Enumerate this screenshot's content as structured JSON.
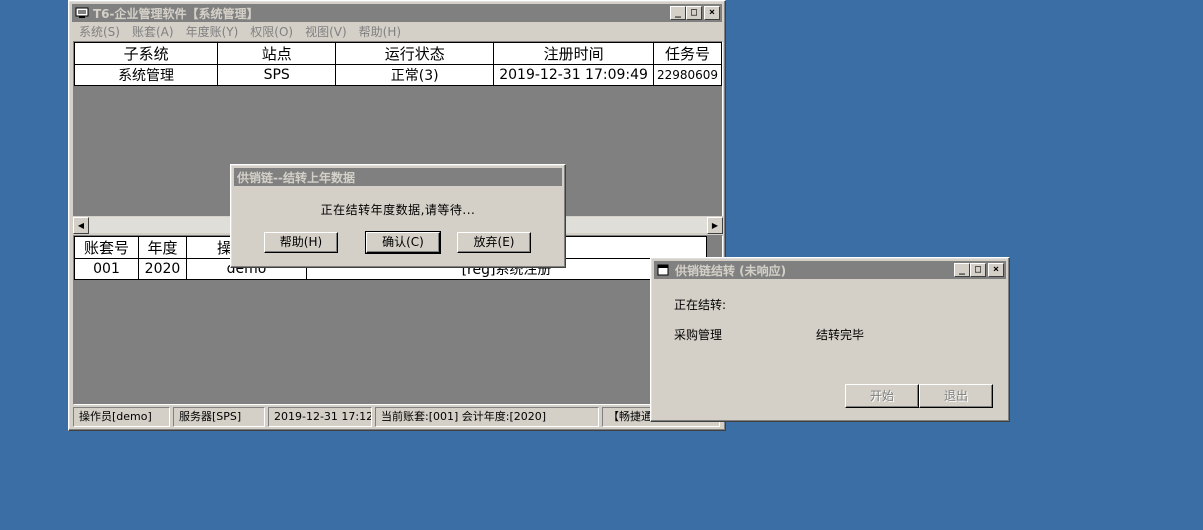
{
  "main_window": {
    "title": "T6-企业管理软件【系统管理】",
    "menu": [
      "系统(S)",
      "账套(A)",
      "年度账(Y)",
      "权限(O)",
      "视图(V)",
      "帮助(H)"
    ],
    "subsystems_table": {
      "columns": [
        "子系统",
        "站点",
        "运行状态",
        "注册时间",
        "任务号"
      ],
      "rows": [
        [
          "系统管理",
          "SPS",
          "正常(3)",
          "2019-12-31 17:09:49",
          "22980609"
        ]
      ]
    },
    "accounts_table": {
      "columns": [
        "账套号",
        "年度",
        "操"
      ],
      "rows": [
        [
          "001",
          "2020",
          "demo",
          "[reg]系统注册"
        ]
      ]
    },
    "status": {
      "operator": "操作员[demo]",
      "server": "服务器[SPS]",
      "datetime": "2019-12-31 17:12",
      "current": "当前账套:[001] 会计年度:[2020]",
      "brand": "【畅捷通软件】"
    }
  },
  "progress_dialog": {
    "title": "供销链--结转上年数据",
    "message": "正在结转年度数据,请等待...",
    "help_label": "帮助(H)",
    "ok_label": "确认(C)",
    "cancel_label": "放弃(E)"
  },
  "transfer_window": {
    "title": "供销链结转 (未响应)",
    "status_label": "正在结转:",
    "module": "采购管理",
    "module_status": "结转完毕",
    "start_label": "开始",
    "exit_label": "退出"
  },
  "colors": {
    "desktop": "#3a6ea5",
    "face": "#d4d0c8",
    "inactive_title": "#808080"
  }
}
